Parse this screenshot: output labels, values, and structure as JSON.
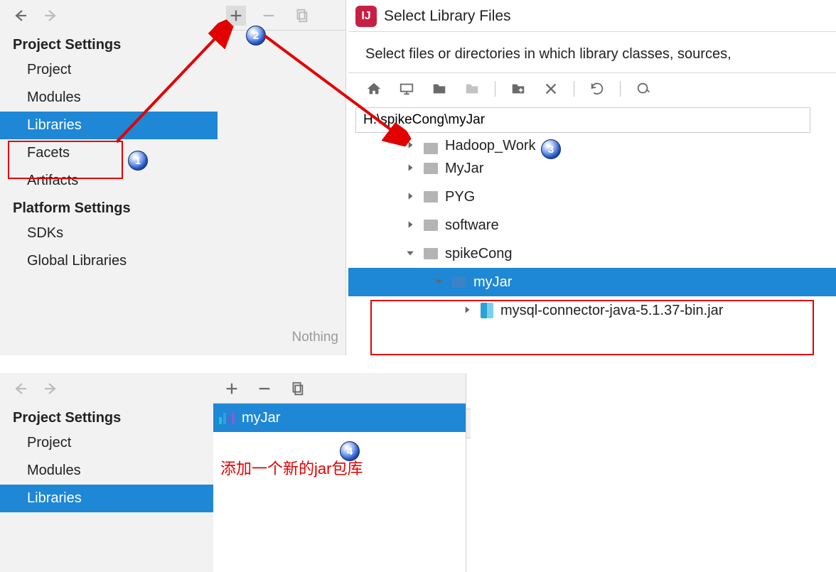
{
  "top": {
    "left": {
      "section1": "Project Settings",
      "items1": [
        "Project",
        "Modules",
        "Libraries",
        "Facets",
        "Artifacts"
      ],
      "section2": "Platform Settings",
      "items2": [
        "SDKs",
        "Global Libraries"
      ]
    },
    "middle": {
      "empty": "Nothing"
    },
    "dialog": {
      "title": "Select Library Files",
      "desc": "Select files or directories in which library classes, sources,",
      "path": "H:\\spikeCong\\myJar",
      "tree": [
        {
          "indent": 1,
          "expand": "right",
          "icon": "folder",
          "label": "Hadoop_Work",
          "cut": true
        },
        {
          "indent": 1,
          "expand": "right",
          "icon": "folder",
          "label": "MyJar"
        },
        {
          "indent": 1,
          "expand": "right",
          "icon": "folder",
          "label": "PYG"
        },
        {
          "indent": 1,
          "expand": "right",
          "icon": "folder",
          "label": "software"
        },
        {
          "indent": 1,
          "expand": "down",
          "icon": "folder",
          "label": "spikeCong"
        },
        {
          "indent": 2,
          "expand": "down",
          "icon": "folder-blue",
          "label": "myJar",
          "selected": true
        },
        {
          "indent": 3,
          "expand": "right",
          "icon": "jar",
          "label": "mysql-connector-java-5.1.37-bin.jar"
        }
      ]
    },
    "badges": {
      "b1": "1",
      "b2": "2",
      "b3": "3"
    }
  },
  "bottom": {
    "left": {
      "section1": "Project Settings",
      "items1": [
        "Project",
        "Modules",
        "Libraries"
      ]
    },
    "lib_name": "myJar",
    "caption": "添加一个新的jar包库",
    "badge": "4"
  }
}
